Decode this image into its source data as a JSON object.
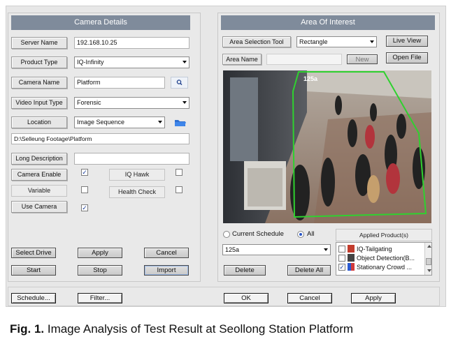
{
  "camera_details": {
    "title": "Camera Details",
    "server_name_label": "Server Name",
    "server_name_value": "192.168.10.25",
    "product_type_label": "Product Type",
    "product_type_value": "IQ-Infinity",
    "camera_name_label": "Camera Name",
    "camera_name_value": "Platform",
    "video_input_type_label": "Video Input Type",
    "video_input_type_value": "Forensic",
    "location_label": "Location",
    "location_value": "Image Sequence",
    "path_value": "D:\\Selleung Footage\\Platform",
    "long_description_label": "Long Description",
    "camera_enable_label": "Camera Enable",
    "iq_hawk_label": "IQ Hawk",
    "variable_label": "Variable",
    "health_check_label": "Health Check",
    "use_camera_label": "Use Camera",
    "select_drive_label": "Select Drive",
    "apply_label": "Apply",
    "cancel_label": "Cancel",
    "start_label": "Start",
    "stop_label": "Stop",
    "import_label": "Import"
  },
  "area_of_interest": {
    "title": "Area Of Interest",
    "selection_tool_label": "Area Selection Tool",
    "selection_tool_value": "Rectangle",
    "live_view_label": "Live View",
    "area_name_label": "Area Name",
    "new_label": "New",
    "open_file_label": "Open File",
    "video_zone_label": "125a",
    "current_schedule_label": "Current Schedule",
    "all_label": "All",
    "applied_products_label": "Applied Product(s)",
    "area_select_value": "125a",
    "delete_label": "Delete",
    "delete_all_label": "Delete All",
    "products": [
      {
        "label": "IQ-Tailgating",
        "checked": false
      },
      {
        "label": "Object Detection(B...",
        "checked": false
      },
      {
        "label": "Stationary Crowd ...",
        "checked": true
      }
    ]
  },
  "footer": {
    "schedule_label": "Schedule...",
    "filter_label": "Filter...",
    "ok_label": "OK",
    "cancel_label": "Cancel",
    "apply_label": "Apply"
  },
  "caption": {
    "prefix": "Fig. 1.",
    "text": " Image Analysis of Test Result at Seollong Station Platform"
  },
  "colors": {
    "header_bg": "#7f8b9b",
    "roi_green": "#2fd12f",
    "radio_selected": "#2a56c6"
  }
}
